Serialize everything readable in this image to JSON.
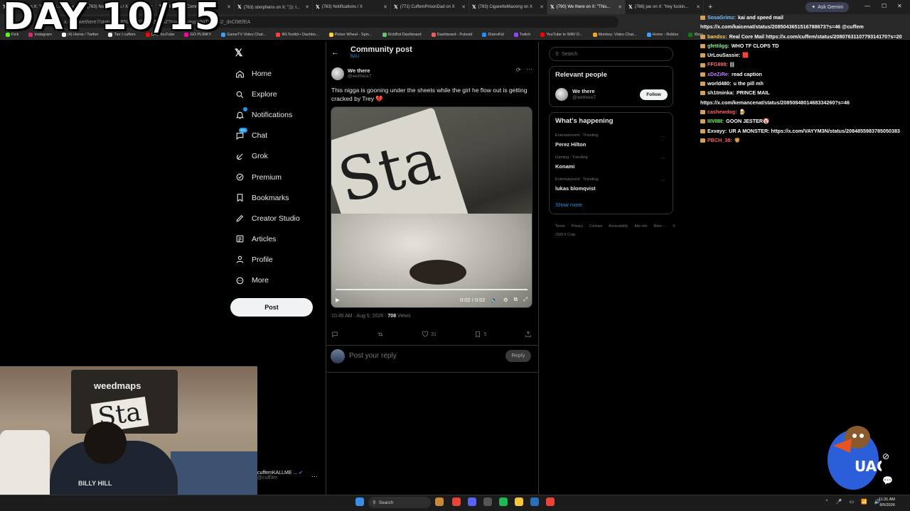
{
  "overlay": {
    "day_text": "DAY 10/15"
  },
  "browser": {
    "tabs": [
      "(780) Lilz on X: \"why fuck...",
      "(763) Notifications / X",
      "(763) BAU Community / X",
      "(763) sbmpfwins on X: \"🎥 I...",
      "(763) Notifications / X",
      "(771) CuffemPrisonDad on X",
      "(783) CigaretteMaxxing on X",
      "(790) We there on X: \"This...",
      "(788) jae on X: \"trey fuckin..."
    ],
    "active_tab_index": 7,
    "ask_gemini": "Ask Gemini",
    "url": "x.com/wethere7/status/2085074762526458962?s=46&t=aypy9qTO2dS2_dxCl9EfEA",
    "bookmarks": [
      "Kick",
      "Instagram",
      "(4) Home / Twitter",
      "Tier | cuffem",
      "(37) YouTube",
      "GO PLINKY",
      "GameTV Video Chat...",
      "IRLToolkit • Dashbo...",
      "Picker Wheel - Spin...",
      "KickBot Dashboard",
      "Dashboard - Pulsoid",
      "DistroKid",
      "Twitch",
      "YouTube to WAV D...",
      "Monkey: Video Chat...",
      "Home - Roblox",
      "Xbox"
    ]
  },
  "nav": {
    "items": [
      {
        "label": "Home",
        "icon": "home-icon"
      },
      {
        "label": "Explore",
        "icon": "search-icon"
      },
      {
        "label": "Notifications",
        "icon": "bell-icon",
        "badge": ""
      },
      {
        "label": "Chat",
        "icon": "chat-icon",
        "badge": "20+"
      },
      {
        "label": "Grok",
        "icon": "grok-icon"
      },
      {
        "label": "Premium",
        "icon": "premium-icon"
      },
      {
        "label": "Bookmarks",
        "icon": "bookmark-icon"
      },
      {
        "label": "Creator Studio",
        "icon": "creator-studio-icon"
      },
      {
        "label": "Articles",
        "icon": "articles-icon"
      },
      {
        "label": "Profile",
        "icon": "profile-icon"
      },
      {
        "label": "More",
        "icon": "more-icon"
      }
    ],
    "post_button": "Post",
    "account_name": "cuffemKALLME ...",
    "account_handle": "@cuff3m"
  },
  "main": {
    "title": "Community post",
    "subtitle": "BAU",
    "post": {
      "author": "We there",
      "handle": "@wethere7",
      "text": "This nigga is gooning under the sheets while the girl he flow out is getting cracked by Trey 💔",
      "video_time": "0:02 / 0:02",
      "video_progress": 1.0,
      "time": "10:45 AM · Aug 5, 2026 ·",
      "views": "708",
      "views_label": "Views",
      "likes": "31",
      "bookmarks": "5"
    },
    "reply_placeholder": "Post your reply",
    "reply_button": "Reply"
  },
  "right": {
    "search_placeholder": "Search",
    "relevant_title": "Relevant people",
    "relevant_name": "We there",
    "relevant_handle": "@wethere7",
    "follow_label": "Follow",
    "trends_title": "What's happening",
    "trends": [
      {
        "cat": "Entertainment · Trending",
        "name": "Perez Hilton"
      },
      {
        "cat": "Gaming · Trending",
        "name": "Konami"
      },
      {
        "cat": "Entertainment · Trending",
        "name": "lukas blomqvist"
      }
    ],
    "show_more": "Show more",
    "footer": [
      "Terms",
      "Privacy",
      "Cookies",
      "Accessibility",
      "Ads info",
      "More ···",
      "© 2026 X Corp."
    ]
  },
  "chat": [
    {
      "user": "SosaGrimz:",
      "color": "#6ec0ff",
      "msg": "kai and speed mail https://x.com/kaicenat/status/2085043651516788673?s=46 @cuffem"
    },
    {
      "user": "bandss:",
      "color": "#ffd166",
      "msg": "Real Core Mail https://x.com/cuffem/status/2080763110779314170?s=20"
    },
    {
      "user": "gfettilgg:",
      "color": "#8ef08e",
      "msg": "WHO TF CLOPS TD"
    },
    {
      "user": "UrLouSassie:",
      "color": "#ffffff",
      "msg": "🟥"
    },
    {
      "user": "FFG999:",
      "color": "#ff6b6b",
      "msg": "|||"
    },
    {
      "user": "xDeZiRe:",
      "color": "#c77dff",
      "msg": "read caption"
    },
    {
      "user": "world480:",
      "color": "#ffffff",
      "msg": "u the pill mh"
    },
    {
      "user": "sh1tminka:",
      "color": "#ffffff",
      "msg": "PRINCE MAIL https://x.com/kemancenat/status/2085084801468334260?s=46"
    },
    {
      "user": "cashewdog:",
      "color": "#ff5e5e",
      "msg": "🍺"
    },
    {
      "user": "IIIVIIIII:",
      "color": "#7cff6b",
      "msg": "GOON JESTER🤡"
    },
    {
      "user": "Exvayy:",
      "color": "#ffffff",
      "msg": "UR A MONSTER: https://x.com/VAYYM3N/status/2084855983785050383"
    },
    {
      "user": "PBCH_38:",
      "color": "#ff5e5e",
      "msg": "🦁"
    }
  ],
  "webcam": {
    "headboard_text": "weedmaps",
    "pillow_text": "Sta",
    "shirt_text": "BILLY HILL"
  },
  "taskbar": {
    "search": "Search",
    "time": "11:31 AM",
    "date": "8/5/2026"
  },
  "colors": {
    "x_blue": "#1d9bf0",
    "background": "#000000",
    "border": "#2f3336"
  }
}
